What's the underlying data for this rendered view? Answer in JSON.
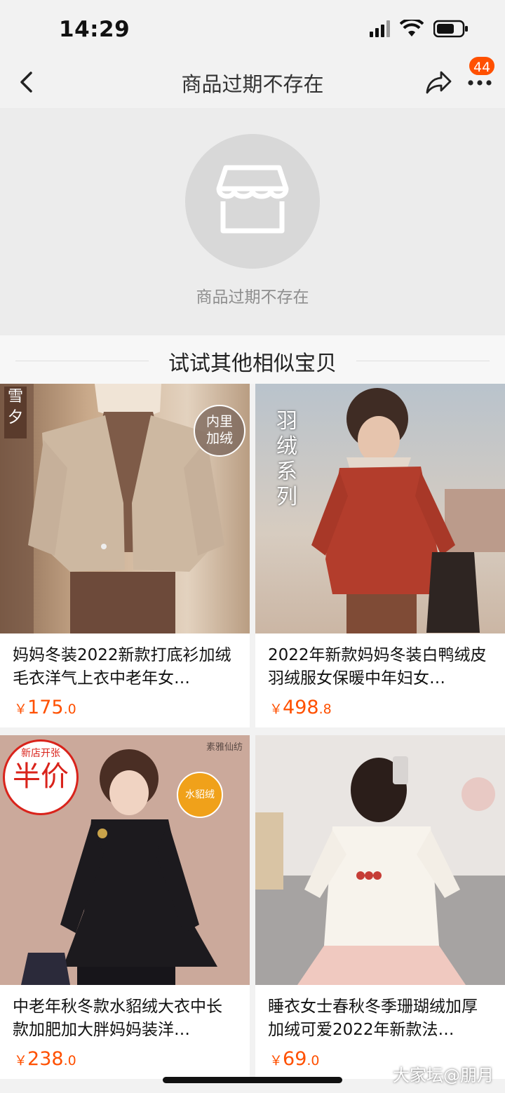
{
  "status_bar": {
    "time": "14:29",
    "icons": [
      "signal-icon",
      "wifi-icon",
      "battery-icon"
    ]
  },
  "nav": {
    "title": "商品过期不存在",
    "badge_count": "44",
    "icons": [
      "back-icon",
      "share-icon",
      "more-icon"
    ]
  },
  "expired": {
    "message": "商品过期不存在",
    "icon": "store-icon"
  },
  "similar": {
    "title": "试试其他相似宝贝"
  },
  "products": [
    {
      "title": "妈妈冬装2022新款打底衫加绒毛衣洋气上衣中老年女…",
      "currency": "￥",
      "price_int": "175",
      "price_dec": ".0",
      "tags": [
        "雪夕",
        "内里",
        "加绒"
      ]
    },
    {
      "title": "2022年新款妈妈冬装白鸭绒皮羽绒服女保暖中年妇女…",
      "currency": "￥",
      "price_int": "498",
      "price_dec": ".8",
      "tags": [
        "羽绒系列"
      ]
    },
    {
      "title": "中老年秋冬款水貂绒大衣中长款加肥加大胖妈妈装洋…",
      "currency": "￥",
      "price_int": "238",
      "price_dec": ".0",
      "tags": [
        "新店开张",
        "半价",
        "素雅仙纺",
        "水貂绒"
      ]
    },
    {
      "title": "睡衣女士春秋冬季珊瑚绒加厚加绒可爱2022年新款法…",
      "currency": "￥",
      "price_int": "69",
      "price_dec": ".0",
      "tags": []
    }
  ],
  "watermark": "大家坛@朋月",
  "colors": {
    "price": "#ff5000",
    "badge": "#ff5000",
    "background": "#f2f2f2"
  }
}
